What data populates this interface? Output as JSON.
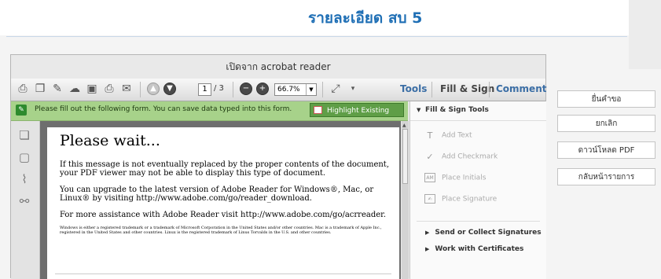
{
  "page": {
    "title": "รายละเอียด สบ 5"
  },
  "viewer": {
    "window_title": "เปิดจาก acrobat reader",
    "toolbar": {
      "page_current": "1",
      "page_total": "/ 3",
      "zoom": "66.7%",
      "tools_label": "Tools",
      "fill_sign_label": "Fill & Sign",
      "comment_label": "Comment",
      "icons": [
        "create-pdf-icon",
        "convert-icon",
        "edit-icon",
        "cloud-icon",
        "save-icon",
        "print-icon",
        "email-icon",
        "prev-page-icon",
        "next-page-icon",
        "zoom-out-icon",
        "zoom-in-icon",
        "fit-page-icon",
        "more-icon"
      ]
    },
    "notice": {
      "text": "Please fill out the following form. You can save data typed into this form.",
      "button_label": "Highlight Existing Fields"
    },
    "document": {
      "heading": "Please wait...",
      "para1": "If this message is not eventually replaced by the proper contents of the document, your PDF viewer may not be able to display this type of document.",
      "para2": "You can upgrade to the latest version of Adobe Reader for Windows®, Mac, or Linux® by visiting  http://www.adobe.com/go/reader_download.",
      "para3": "For more assistance with Adobe Reader visit  http://www.adobe.com/go/acrreader.",
      "small": "Windows is either a registered trademark or a trademark of Microsoft Corporation in the United States and/or other countries. Mac is a trademark of Apple Inc., registered in the United States and other countries. Linux is the registered trademark of Linus Torvalds in the U.S. and other countries."
    },
    "panel": {
      "header": "Fill & Sign Tools",
      "tools": [
        "Add Text",
        "Add Checkmark",
        "Place Initials",
        "Place Signature"
      ],
      "sections": [
        "Send or Collect Signatures",
        "Work with Certificates"
      ]
    }
  },
  "actions": {
    "submit": "ยื่นคำขอ",
    "cancel": "ยกเลิก",
    "download": "ดาวน์โหลด PDF",
    "back": "กลับหน้ารายการ"
  },
  "colors": {
    "title": "#1f6fb5",
    "notice_bg": "#a7d28a",
    "notice_button": "#5f9e47",
    "link_blue": "#3b6ea5"
  }
}
